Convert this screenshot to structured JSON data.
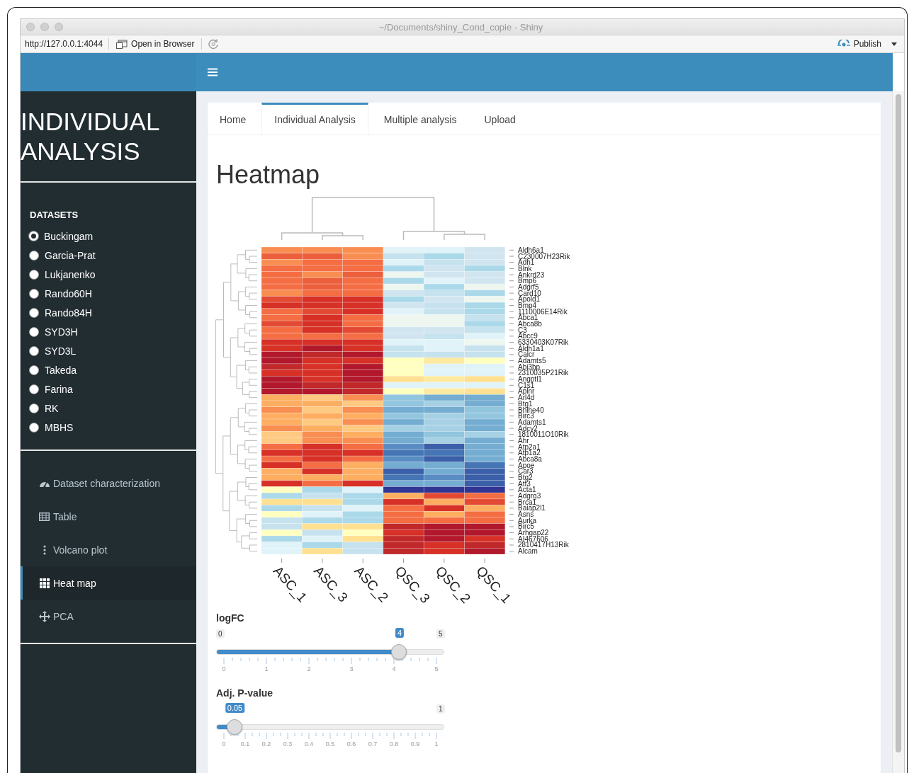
{
  "window": {
    "title": "~/Documents/shiny_Cond_copie - Shiny"
  },
  "toolbar": {
    "url": "http://127.0.0.1:4044",
    "open_button": "Open in Browser",
    "publish_button": "Publish"
  },
  "sidebar": {
    "title": "INDIVIDUAL ANALYSIS",
    "datasets_heading": "DATASETS",
    "datasets": [
      {
        "label": "Buckingam",
        "selected": true
      },
      {
        "label": "Garcia-Prat",
        "selected": false
      },
      {
        "label": "Lukjanenko",
        "selected": false
      },
      {
        "label": "Rando60H",
        "selected": false
      },
      {
        "label": "Rando84H",
        "selected": false
      },
      {
        "label": "SYD3H",
        "selected": false
      },
      {
        "label": "SYD3L",
        "selected": false
      },
      {
        "label": "Takeda",
        "selected": false
      },
      {
        "label": "Farina",
        "selected": false
      },
      {
        "label": "RK",
        "selected": false
      },
      {
        "label": "MBHS",
        "selected": false
      }
    ],
    "menu": [
      {
        "label": "Dataset characterization",
        "kind": "gauge",
        "selected": false
      },
      {
        "label": "Table",
        "kind": "table",
        "selected": false
      },
      {
        "label": "Volcano plot",
        "kind": "dots",
        "selected": false
      },
      {
        "label": "Heat map",
        "kind": "grid",
        "selected": true
      },
      {
        "label": "PCA",
        "kind": "move",
        "selected": false
      }
    ]
  },
  "tabs": [
    {
      "label": "Home",
      "selected": false
    },
    {
      "label": "Individual Analysis",
      "selected": true
    },
    {
      "label": "Multiple analysis",
      "selected": false
    },
    {
      "label": "Upload",
      "selected": false
    }
  ],
  "heading": "Heatmap",
  "heatmap": {
    "samples": [
      "ASC_1",
      "ASC_3",
      "ASC_2",
      "QSC_3",
      "QSC_2",
      "QSC_1"
    ],
    "genes": [
      "Aldh6a1",
      "C230007H23Rik",
      "Adh1",
      "Blnk",
      "Ankrd23",
      "Bmp6",
      "Adgrf5",
      "Card10",
      "Apold1",
      "Bmp4",
      "1110006E14Rik",
      "Abca1",
      "Abca8b",
      "C3",
      "Abcc9",
      "6330403K07Rik",
      "Aldh1a1",
      "Calcr",
      "Adamts5",
      "Abi3bp",
      "2310035P21Rik",
      "Angptl1",
      "C1s1",
      "Aplnr",
      "Arl4d",
      "Btg1",
      "Bhlhe40",
      "Birc3",
      "Adamts1",
      "Adcy2",
      "1810011O10Rik",
      "Ahr",
      "Atp2a1",
      "Atp1a2",
      "Abca8a",
      "Apoe",
      "Car3",
      "Btg2",
      "Atf3",
      "Acta1",
      "Adgrg3",
      "Brca1",
      "Baiap2l1",
      "Asns",
      "Aurka",
      "Birc5",
      "Arhgap22",
      "AI467606",
      "2810417H13Rik",
      "Alcam"
    ]
  },
  "sliders": [
    {
      "label": "logFC",
      "min": "0",
      "max": "5",
      "value": "4",
      "level": 0.8,
      "ticks": [
        "0",
        "1",
        "2",
        "3",
        "4",
        "5"
      ]
    },
    {
      "label": "Adj. P-value",
      "max": "1",
      "value": "0.05",
      "level": 0.05,
      "ticks": [
        "0",
        "0.1",
        "0.2",
        "0.3",
        "0.4",
        "0.5",
        "0.6",
        "0.7",
        "0.8",
        "0.9",
        "1"
      ]
    }
  ]
}
